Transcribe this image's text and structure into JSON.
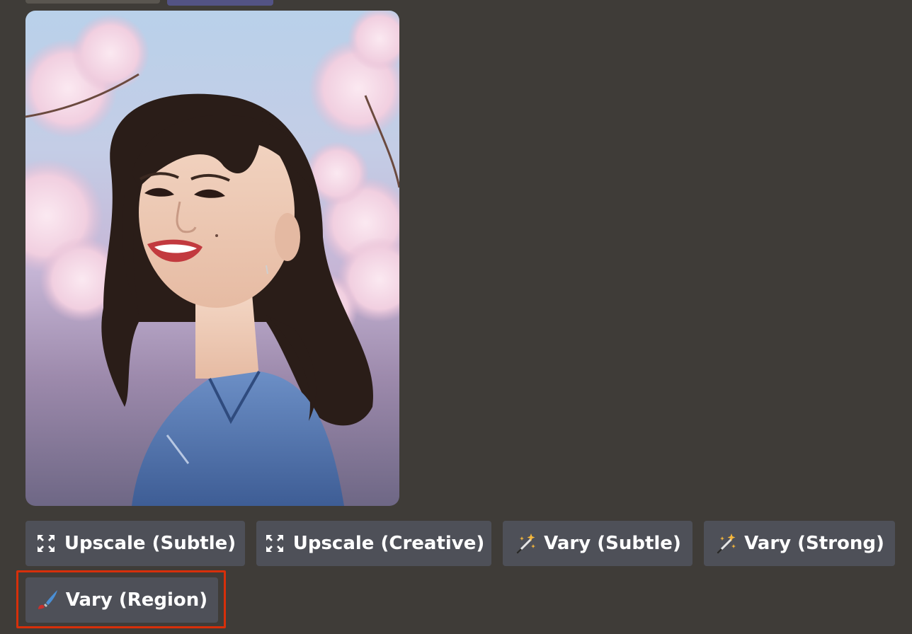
{
  "buttons": [
    {
      "label": "Upscale (Subtle)",
      "icon": "expand-arrows-icon"
    },
    {
      "label": "Upscale (Creative)",
      "icon": "expand-arrows-icon"
    },
    {
      "label": "Vary (Subtle)",
      "icon": "magic-wand-icon"
    },
    {
      "label": "Vary (Strong)",
      "icon": "magic-wand-icon"
    }
  ],
  "vary_region": {
    "label": "Vary (Region)",
    "icon": "paintbrush-icon"
  },
  "colors": {
    "background": "#3f3c38",
    "button": "#4e5058",
    "button_text": "#ffffff",
    "highlight": "#d72f0a",
    "mention": "#535385"
  }
}
